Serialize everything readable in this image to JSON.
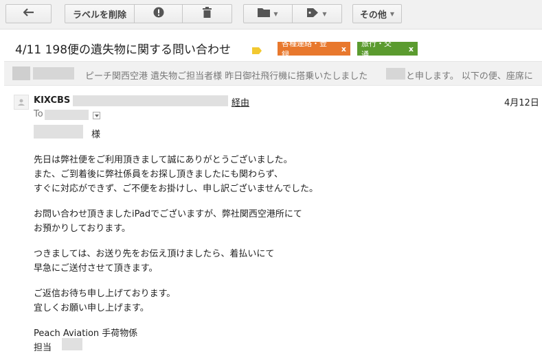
{
  "toolbar": {
    "back_icon": "reply-arrow-icon",
    "remove_label": "ラベルを削除",
    "report_icon": "exclamation-icon",
    "delete_icon": "trash-icon",
    "move_icon": "folder-icon",
    "labels_icon": "tag-icon",
    "more_label": "その他",
    "caret": "▼"
  },
  "message": {
    "subject": "4/11 198便の遺失物に関する問い合わせ",
    "labels": [
      {
        "name": "各種連絡・登録",
        "remove": "x",
        "color": "#e8782d"
      },
      {
        "name": "旅行・交通",
        "remove": "x",
        "color": "#5b9b2f"
      }
    ]
  },
  "collapsed": {
    "snippet": "ピーチ関西空港 遺失物ご担当者様 昨日御社飛行機に搭乗いたしました",
    "snippet_tail": "と申します。 以下の便、座席に"
  },
  "header": {
    "sender": "KIXCBS",
    "via": "経由",
    "date": "4月12日",
    "to_label": "To"
  },
  "body": {
    "salutation": "様",
    "lines": [
      "先日は弊社便をご利用頂きまして誠にありがとうございました。",
      "また、ご到着後に弊社係員をお探し頂きましたにも関わらず、",
      "すぐに対応ができず、ご不便をお掛けし、申し訳ございませんでした。",
      "お問い合わせ頂きましたiPadでございますが、弊社関西空港所にて",
      "お預かりしております。",
      "つきましては、お送り先をお伝え頂けましたら、着払いにて",
      "早急にご送付させて頂きます。",
      "ご返信お待ち申し上げております。",
      "宜しくお願い申し上げます。",
      "Peach Aviation 手荷物係",
      "担当"
    ]
  }
}
